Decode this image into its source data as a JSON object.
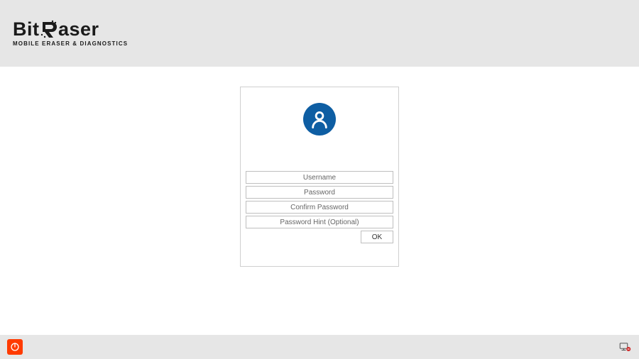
{
  "brand": {
    "name": "BitRaser",
    "tagline": "MOBILE ERASER & DIAGNOSTICS"
  },
  "login": {
    "username_placeholder": "Username",
    "password_placeholder": "Password",
    "confirm_placeholder": "Confirm Password",
    "hint_placeholder": "Password Hint (Optional)",
    "ok_label": "OK"
  },
  "icons": {
    "avatar": "user-icon",
    "power": "power-icon",
    "network": "network-disconnected-icon"
  },
  "colors": {
    "header_bg": "#e6e6e6",
    "card_border": "#cfcfcf",
    "avatar_bg": "#0e5ea3",
    "power_bg": "#ff3b00"
  }
}
